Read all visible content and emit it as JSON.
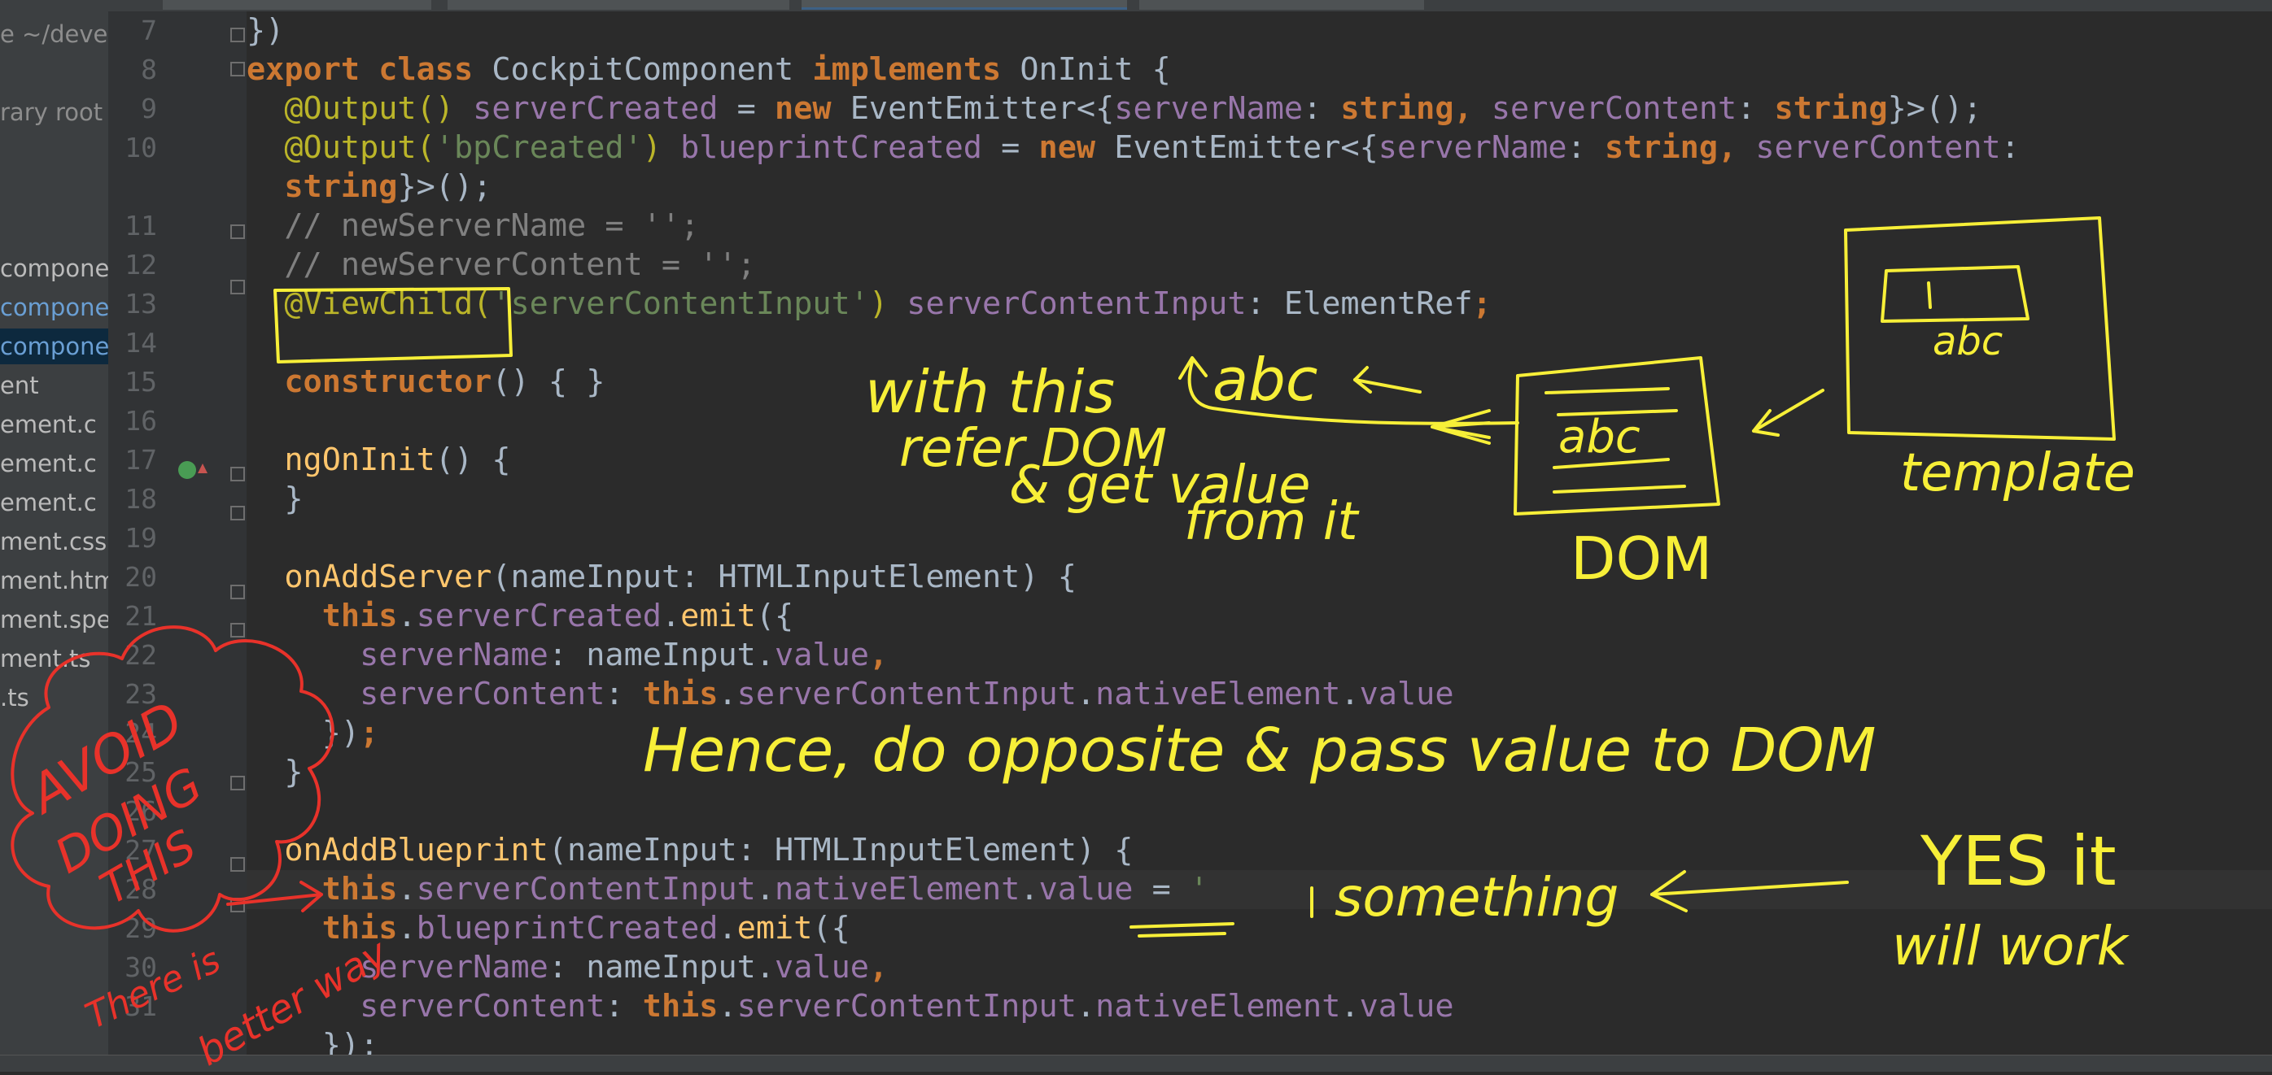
{
  "editor": {
    "lines": [
      {
        "num": "7",
        "tokens": [
          {
            "t": "})",
            "c": "txt"
          }
        ]
      },
      {
        "num": "8",
        "tokens": [
          {
            "t": "export ",
            "c": "kw"
          },
          {
            "t": "class ",
            "c": "kw"
          },
          {
            "t": "CockpitComponent ",
            "c": "txt"
          },
          {
            "t": "implements ",
            "c": "kw"
          },
          {
            "t": "OnInit {",
            "c": "txt"
          }
        ]
      },
      {
        "num": "9",
        "tokens": [
          {
            "t": "  @Output() ",
            "c": "ann"
          },
          {
            "t": "serverCreated",
            "c": "field"
          },
          {
            "t": " = ",
            "c": "txt"
          },
          {
            "t": "new ",
            "c": "kw"
          },
          {
            "t": "EventEmitter<{",
            "c": "txt"
          },
          {
            "t": "serverName",
            "c": "field"
          },
          {
            "t": ": ",
            "c": "txt"
          },
          {
            "t": "string",
            "c": "kw"
          },
          {
            "t": ", ",
            "c": "kw"
          },
          {
            "t": "serverContent",
            "c": "field"
          },
          {
            "t": ": ",
            "c": "txt"
          },
          {
            "t": "string",
            "c": "kw"
          },
          {
            "t": "}>();",
            "c": "txt"
          }
        ]
      },
      {
        "num": "10",
        "tokens": [
          {
            "t": "  @Output(",
            "c": "ann"
          },
          {
            "t": "'bpCreated'",
            "c": "str"
          },
          {
            "t": ") ",
            "c": "ann"
          },
          {
            "t": "blueprintCreated",
            "c": "field"
          },
          {
            "t": " = ",
            "c": "txt"
          },
          {
            "t": "new ",
            "c": "kw"
          },
          {
            "t": "EventEmitter<{",
            "c": "txt"
          },
          {
            "t": "serverName",
            "c": "field"
          },
          {
            "t": ": ",
            "c": "txt"
          },
          {
            "t": "string",
            "c": "kw"
          },
          {
            "t": ", ",
            "c": "kw"
          },
          {
            "t": "serverContent",
            "c": "field"
          },
          {
            "t": ":",
            "c": "txt"
          }
        ]
      },
      {
        "num": "",
        "tokens": [
          {
            "t": "  string",
            "c": "kw"
          },
          {
            "t": "}>();",
            "c": "txt"
          }
        ]
      },
      {
        "num": "11",
        "tokens": [
          {
            "t": "  // newServerName = '';",
            "c": "cmt"
          }
        ]
      },
      {
        "num": "12",
        "tokens": [
          {
            "t": "  // newServerContent = '';",
            "c": "cmt"
          }
        ]
      },
      {
        "num": "13",
        "tokens": [
          {
            "t": "  @ViewChild(",
            "c": "ann"
          },
          {
            "t": "'serverContentInput'",
            "c": "str"
          },
          {
            "t": ") ",
            "c": "ann"
          },
          {
            "t": "serverContentInput",
            "c": "field"
          },
          {
            "t": ": ElementRef",
            "c": "txt"
          },
          {
            "t": ";",
            "c": "kw"
          }
        ]
      },
      {
        "num": "14",
        "tokens": []
      },
      {
        "num": "15",
        "tokens": [
          {
            "t": "  constructor",
            "c": "kw"
          },
          {
            "t": "() { }",
            "c": "txt"
          }
        ]
      },
      {
        "num": "16",
        "tokens": []
      },
      {
        "num": "17",
        "tokens": [
          {
            "t": "  ngOnInit",
            "c": "fn"
          },
          {
            "t": "() {",
            "c": "txt"
          }
        ]
      },
      {
        "num": "18",
        "tokens": [
          {
            "t": "  }",
            "c": "txt"
          }
        ]
      },
      {
        "num": "19",
        "tokens": []
      },
      {
        "num": "20",
        "tokens": [
          {
            "t": "  onAddServer",
            "c": "fn"
          },
          {
            "t": "(nameInput: HTMLInputElement) {",
            "c": "txt"
          }
        ]
      },
      {
        "num": "21",
        "tokens": [
          {
            "t": "    this",
            "c": "kw"
          },
          {
            "t": ".",
            "c": "txt"
          },
          {
            "t": "serverCreated",
            "c": "field"
          },
          {
            "t": ".",
            "c": "txt"
          },
          {
            "t": "emit",
            "c": "fn"
          },
          {
            "t": "({",
            "c": "txt"
          }
        ]
      },
      {
        "num": "22",
        "tokens": [
          {
            "t": "      serverName",
            "c": "field"
          },
          {
            "t": ": nameInput.",
            "c": "txt"
          },
          {
            "t": "value",
            "c": "field"
          },
          {
            "t": ",",
            "c": "kw"
          }
        ]
      },
      {
        "num": "23",
        "tokens": [
          {
            "t": "      serverContent",
            "c": "field"
          },
          {
            "t": ": ",
            "c": "txt"
          },
          {
            "t": "this",
            "c": "kw"
          },
          {
            "t": ".",
            "c": "txt"
          },
          {
            "t": "serverContentInput",
            "c": "field"
          },
          {
            "t": ".",
            "c": "txt"
          },
          {
            "t": "nativeElement",
            "c": "field"
          },
          {
            "t": ".",
            "c": "txt"
          },
          {
            "t": "value",
            "c": "field"
          }
        ]
      },
      {
        "num": "24",
        "tokens": [
          {
            "t": "    })",
            "c": "txt"
          },
          {
            "t": ";",
            "c": "kw"
          }
        ]
      },
      {
        "num": "25",
        "tokens": [
          {
            "t": "  }",
            "c": "txt"
          }
        ]
      },
      {
        "num": "26",
        "tokens": []
      },
      {
        "num": "27",
        "tokens": [
          {
            "t": "  onAddBlueprint",
            "c": "fn"
          },
          {
            "t": "(nameInput: HTMLInputElement) {",
            "c": "txt"
          }
        ]
      },
      {
        "num": "28",
        "tokens": [
          {
            "t": "    this",
            "c": "kw"
          },
          {
            "t": ".",
            "c": "txt"
          },
          {
            "t": "serverContentInput",
            "c": "field"
          },
          {
            "t": ".",
            "c": "txt"
          },
          {
            "t": "nativeElement",
            "c": "field"
          },
          {
            "t": ".",
            "c": "txt"
          },
          {
            "t": "value",
            "c": "field"
          },
          {
            "t": " = ",
            "c": "txt"
          },
          {
            "t": "'",
            "c": "str"
          }
        ]
      },
      {
        "num": "29",
        "tokens": [
          {
            "t": "    this",
            "c": "kw"
          },
          {
            "t": ".",
            "c": "txt"
          },
          {
            "t": "blueprintCreated",
            "c": "field"
          },
          {
            "t": ".",
            "c": "txt"
          },
          {
            "t": "emit",
            "c": "fn"
          },
          {
            "t": "({",
            "c": "txt"
          }
        ]
      },
      {
        "num": "30",
        "tokens": [
          {
            "t": "      serverName",
            "c": "field"
          },
          {
            "t": ": nameInput.",
            "c": "txt"
          },
          {
            "t": "value",
            "c": "field"
          },
          {
            "t": ",",
            "c": "kw"
          }
        ]
      },
      {
        "num": "31",
        "tokens": [
          {
            "t": "      serverContent",
            "c": "field"
          },
          {
            "t": ": ",
            "c": "txt"
          },
          {
            "t": "this",
            "c": "kw"
          },
          {
            "t": ".",
            "c": "txt"
          },
          {
            "t": "serverContentInput",
            "c": "field"
          },
          {
            "t": ".",
            "c": "txt"
          },
          {
            "t": "nativeElement",
            "c": "field"
          },
          {
            "t": ".",
            "c": "txt"
          },
          {
            "t": "value",
            "c": "field"
          }
        ]
      },
      {
        "num": "",
        "tokens": [
          {
            "t": "    });",
            "c": "txt"
          }
        ]
      }
    ]
  },
  "sidebar": {
    "items": [
      {
        "label": "e ~/deve",
        "state": "dim"
      },
      {
        "label": "",
        "state": ""
      },
      {
        "label": "rary root",
        "state": "dim"
      },
      {
        "label": "",
        "state": ""
      },
      {
        "label": "",
        "state": ""
      },
      {
        "label": "",
        "state": ""
      },
      {
        "label": "compone",
        "state": ""
      },
      {
        "label": "compone",
        "state": "sel2"
      },
      {
        "label": "compone",
        "state": "sel"
      },
      {
        "label": "ent",
        "state": ""
      },
      {
        "label": "ement.c",
        "state": ""
      },
      {
        "label": "ement.c",
        "state": ""
      },
      {
        "label": "ement.c",
        "state": ""
      },
      {
        "label": "ment.css",
        "state": ""
      },
      {
        "label": "ment.htm",
        "state": ""
      },
      {
        "label": "ment.spe",
        "state": ""
      },
      {
        "label": "ment.ts",
        "state": ""
      },
      {
        "label": ".ts",
        "state": ""
      }
    ]
  },
  "annotations": {
    "with_this": "with this",
    "refer_dom": "refer DOM",
    "get_value": "& get value",
    "from_it": "from it",
    "abc_arrow": "abc",
    "dom_box_text": "abc",
    "dom_label": "DOM",
    "template_input_text": "abc",
    "template_label": "template",
    "hence": "Hence, do opposite & pass value to DOM",
    "something": "something",
    "yes": "YES it",
    "will_work": "will work",
    "avoid_1": "AVOID",
    "avoid_2": "DOING",
    "avoid_3": "THIS",
    "better_1": "There is",
    "better_2": "better way"
  },
  "colors": {
    "annotation_yellow": "#f7ef38",
    "annotation_red": "#e8322a"
  }
}
